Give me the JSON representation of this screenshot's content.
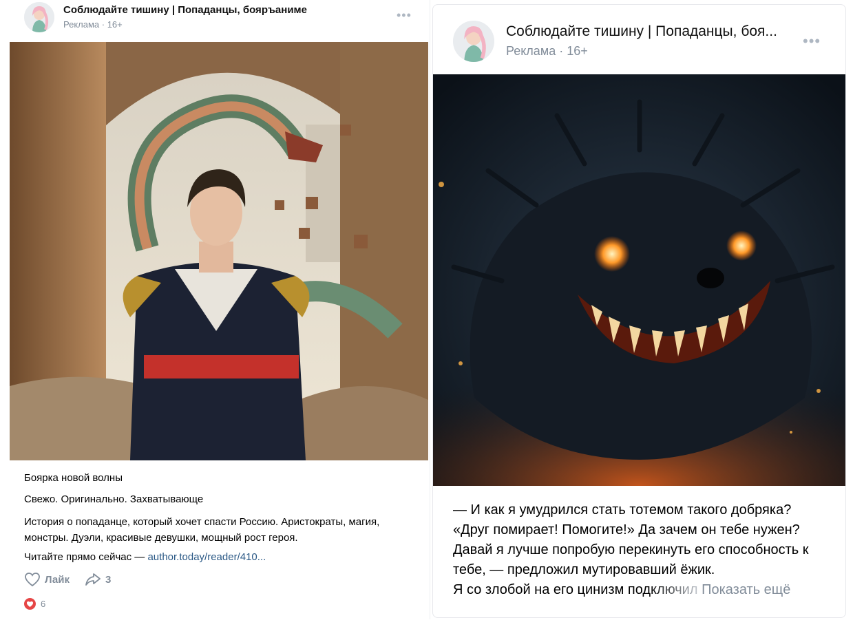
{
  "left_post": {
    "group_name": "Соблюдайте тишину | Попаданцы, бояръаниме",
    "meta": "Реклама · 16+",
    "paragraphs": [
      "Боярка новой волны",
      "Свежо. Оригинально. Захватывающе",
      "История о попаданце, который хочет спасти Россию. Аристократы, магия, монстры. Дуэли, красивые девушки, мощный рост героя."
    ],
    "cta_prefix": "Читайте прямо сейчас — ",
    "cta_link": "author.today/reader/410...",
    "like_label": "Лайк",
    "share_count": "3",
    "reactions_count": "6",
    "icons": [
      "avatar",
      "more-icon",
      "heart-outline-icon",
      "share-icon",
      "heart-filled-icon"
    ]
  },
  "right_post": {
    "group_name": "Соблюдайте тишину | Попаданцы, боя...",
    "meta": "Реклама · 16+",
    "lines": [
      "— И как я умудрился стать тотемом такого добряка?",
      "«Друг помирает! Помогите!» Да зачем он тебе нужен?",
      "Давай я лучше попробую перекинуть его способность к",
      "тебе, — предложил мутировавший ёжик."
    ],
    "last_line": "Я со злобой на его цинизм подключил",
    "show_more": "Показать ещё",
    "icons": [
      "avatar",
      "more-icon"
    ]
  },
  "colors": {
    "link": "#2a5885",
    "meta": "#818c99",
    "heart": "#e64646",
    "border": "#e7e8ec"
  }
}
